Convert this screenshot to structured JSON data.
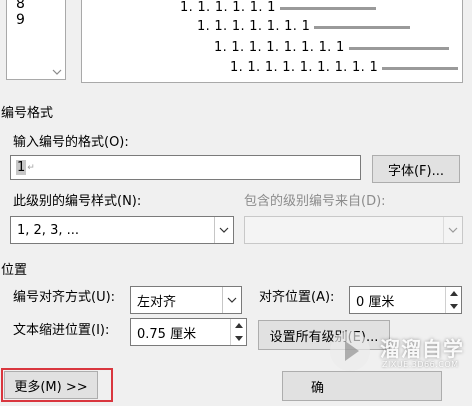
{
  "level_list": {
    "items": [
      "8",
      "9"
    ]
  },
  "preview": {
    "rows": [
      "1. 1. 1. 1. 1. 1",
      "1. 1. 1. 1. 1. 1. 1",
      "1. 1. 1. 1. 1. 1. 1. 1",
      "1. 1. 1. 1. 1. 1. 1. 1. 1"
    ]
  },
  "number_format": {
    "group_label": "编号格式",
    "format_label": "输入编号的格式(O):",
    "format_value": "1",
    "font_button": "字体(F)...",
    "style_label": "此级别的编号样式(N):",
    "style_value": "1, 2, 3, ...",
    "include_label": "包含的级别编号来自(D):",
    "include_value": ""
  },
  "position": {
    "group_label": "位置",
    "alignment_label": "编号对齐方式(U):",
    "alignment_value": "左对齐",
    "align_at_label": "对齐位置(A):",
    "align_at_value": "0 厘米",
    "indent_label": "文本缩进位置(I):",
    "indent_value": "0.75 厘米",
    "set_all_button": "设置所有级别(E)..."
  },
  "footer": {
    "more_button": "更多(M) >>",
    "ok_button_partial": "确"
  },
  "watermark": {
    "title": "溜溜自学",
    "subtitle": "ZIXUE.3D66.COM"
  },
  "colors": {
    "highlight_border": "#d9363e",
    "dialog_bg": "#f0f0f0"
  }
}
